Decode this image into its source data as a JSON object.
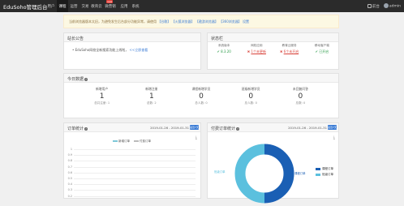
{
  "navbar": {
    "brand": "EduSoho管理后台",
    "items": [
      "用户",
      "课程",
      "运营",
      "交易",
      "教育云",
      "微营销",
      "应用",
      "系统"
    ],
    "new_badge": "new",
    "right_links": {
      "site": "前台",
      "user": "admin"
    }
  },
  "alert": {
    "text": "当前浏览器版本太旧，为避免发生后台部分功能异常，请使用",
    "browsers": [
      "【谷歌】",
      "【火狐浏览器】",
      "【遨游浏览器】",
      "【360浏览器】"
    ],
    "settings_link": "设置"
  },
  "notice_panel": {
    "title": "站长公告",
    "item_text": "EduSoho网校全新搜索功能上线啦，",
    "item_link": "<<立即查看"
  },
  "status_panel": {
    "title": "状态栏",
    "items": [
      {
        "label": "系统版本",
        "value": "8.3.20",
        "status": "ok"
      },
      {
        "label": "网校应用",
        "value": "1个未更新",
        "status": "bad"
      },
      {
        "label": "教育云服务",
        "value": "6个未开启",
        "status": "bad"
      },
      {
        "label": "移动客户端",
        "value": "已开启",
        "status": "ok"
      }
    ]
  },
  "today_panel": {
    "title": "今日数据",
    "stats": [
      {
        "label": "新增用户",
        "value": "1",
        "sub": "总共注册: 1"
      },
      {
        "label": "新增注册",
        "value": "1",
        "sub": "总数: 2"
      },
      {
        "label": "课程新增学员",
        "value": "0",
        "sub": "总人数: 0"
      },
      {
        "label": "班级新增学员",
        "value": "0",
        "sub": "总人数: 0"
      },
      {
        "label": "未回复问答",
        "value": "0",
        "sub": "总数: 0"
      }
    ]
  },
  "order_panel": {
    "title": "订单统计",
    "date_range": "2019-01-26 - 2019-01-31",
    "button": "最近7天",
    "download_icon": "download-icon",
    "legend": [
      "新增订单",
      "付费订单"
    ]
  },
  "paid_panel": {
    "title": "付费订单统计",
    "date_range": "2019-01-26 - 2019-01-31",
    "button": "最近7天",
    "download_icon": "download-icon",
    "legend": [
      "课程订单",
      "班级订单"
    ],
    "slice_labels": [
      "课程订单",
      "班级订单"
    ]
  },
  "chart_data": [
    {
      "type": "line",
      "title": "订单统计",
      "series": [
        {
          "name": "新增订单",
          "values": []
        },
        {
          "name": "付费订单",
          "values": []
        }
      ],
      "y_ticks": [
        "1",
        "0.9",
        "0.8",
        "0.7",
        "0.6",
        "0.5",
        "0.4",
        "0.3",
        "0.2"
      ],
      "ylim": [
        0,
        1
      ]
    },
    {
      "type": "pie",
      "title": "付费订单统计",
      "categories": [
        "课程订单",
        "班级订单"
      ],
      "values": [
        50,
        50
      ],
      "colors": [
        "#1a5fb4",
        "#5bc0de"
      ]
    }
  ]
}
